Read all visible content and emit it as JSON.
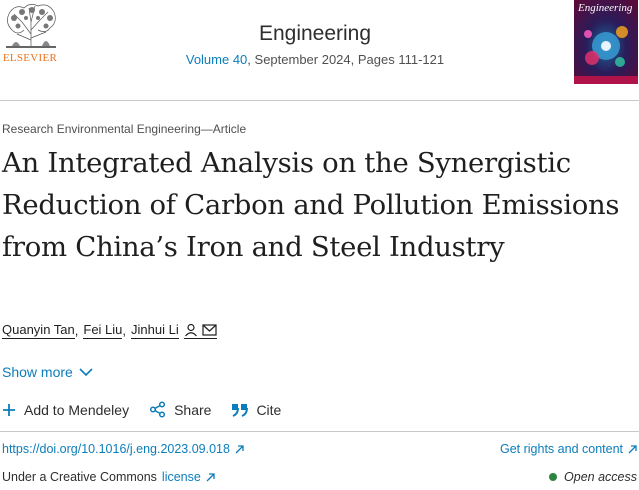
{
  "header": {
    "publisher": "ELSEVIER",
    "journal_title": "Engineering",
    "volume_link": "Volume 40",
    "issue_info": ", September 2024, Pages 111-121",
    "cover_title": "Engineering"
  },
  "article": {
    "type": "Research Environmental Engineering—Article",
    "title": "An Integrated Analysis on the Synergistic Reduction of Carbon and Pollution Emissions from China’s Iron and Steel Industry",
    "authors": [
      "Quanyin Tan",
      "Fei Liu",
      "Jinhui Li"
    ],
    "show_more": "Show more"
  },
  "actions": {
    "mendeley": "Add to Mendeley",
    "share": "Share",
    "cite": "Cite"
  },
  "links": {
    "doi": "https://doi.org/10.1016/j.eng.2023.09.018",
    "rights": "Get rights and content",
    "license_prefix": "Under a Creative Commons",
    "license_link": "license",
    "open_access": "Open access"
  },
  "colors": {
    "link": "#0c7dbb",
    "publisher_orange": "#e9711c",
    "open_access_dot": "#2e8540"
  }
}
